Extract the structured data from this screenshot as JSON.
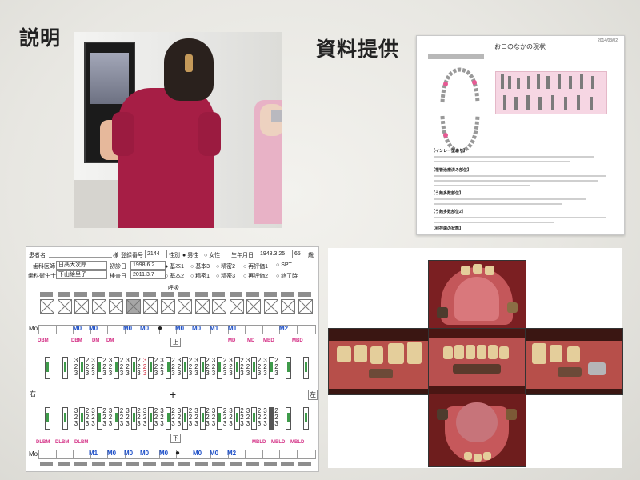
{
  "headings": {
    "left": "説明",
    "right": "資料提供"
  },
  "document": {
    "date": "2014/03/02",
    "title": "お口のなかの現状",
    "sections": [
      "【インレー型あり】",
      "【根管治療済み部位】",
      "【う蝕多数部位】",
      "【う蝕多数部位2】",
      "【残存歯の状態】"
    ]
  },
  "chart": {
    "patient_name_label": "患者名",
    "honorific": "様",
    "reg_no_label": "登録番号",
    "reg_no": "2144",
    "sex_label": "性別",
    "sex_options": [
      "男性",
      "女性"
    ],
    "birth_label": "生年月日",
    "birth_date": "1948.3.25",
    "age": "65",
    "age_unit": "歳",
    "doctor_label": "歯科医師",
    "doctor": "日髙大次郎",
    "first_visit_label": "初診日",
    "first_visit": "1998.6.2",
    "hygienist_label": "歯科衛生士",
    "hygienist": "下山絵里子",
    "exam_label": "検査日",
    "exam_date": "2011.3.7",
    "check_options": [
      "基本1",
      "基本3",
      "精密2",
      "再評価1",
      "SPT",
      "基本2",
      "精密1",
      "精密3",
      "再評価2",
      "終了時"
    ],
    "mo_label": "Mo.",
    "upper_label": "上",
    "lower_label": "下",
    "right_label": "右",
    "left_label": "左",
    "top_mark": "呼吸",
    "upper_mo": [
      "M0",
      "M0",
      "M0",
      "M0",
      "M0",
      "M0",
      "M1",
      "M1",
      "M2"
    ],
    "lower_mo": [
      "M1",
      "M0",
      "M0",
      "M0",
      "M0",
      "M0",
      "M0",
      "M2"
    ],
    "upper_pink": [
      "DBM",
      "DBM",
      "DM",
      "DM",
      "MD",
      "MD",
      "MBD",
      "MBD"
    ],
    "lower_pink": [
      "DLBM",
      "DLBM",
      "DLBM",
      "MBLD",
      "MBLD",
      "MBLD"
    ]
  }
}
